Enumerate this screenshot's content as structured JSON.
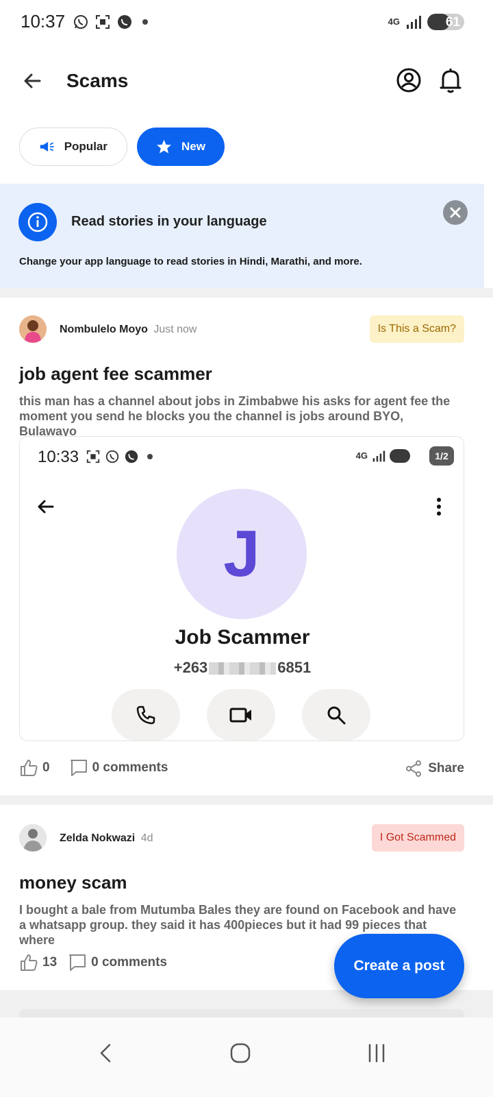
{
  "status_bar": {
    "time": "10:37",
    "network": "4G",
    "battery": "61",
    "battery_level": 0.61
  },
  "header": {
    "title": "Scams"
  },
  "tabs": [
    {
      "label": "Popular",
      "active": false
    },
    {
      "label": "New",
      "active": true
    }
  ],
  "language_banner": {
    "title": "Read stories in your language",
    "subtitle": "Change your app language to read stories in Hindi, Marathi, and more."
  },
  "posts": [
    {
      "author": "Nombulelo Moyo",
      "time": "Just now",
      "badge": "Is This a Scam?",
      "title": "job agent fee scammer",
      "body": "this man has a channel about jobs in Zimbabwe his asks for agent fee the moment you send he blocks you the channel is jobs around BYO, Bulawayo",
      "image": {
        "time": "10:33",
        "network": "4G",
        "page_counter": "1/2",
        "contact_initial": "J",
        "contact_name": "Job Scammer",
        "number_prefix": "+263",
        "number_suffix": "6851"
      },
      "likes": "0",
      "comments": "0 comments",
      "share_label": "Share"
    },
    {
      "author": "Zelda Nokwazi",
      "time": "4d",
      "badge": "I Got Scammed",
      "title": "money scam",
      "body": "I bought a bale from Mutumba Bales they are found on Facebook and have a whatsapp group. they said it has 400pieces but it had 99 pieces that where",
      "likes": "13",
      "comments": "0 comments"
    }
  ],
  "fab": {
    "label": "Create a post"
  },
  "colors": {
    "accent": "#0b63ef",
    "banner_bg": "#e7f0fc",
    "badge_yellow": "#fdf1c8",
    "badge_red": "#fcd9d6"
  }
}
